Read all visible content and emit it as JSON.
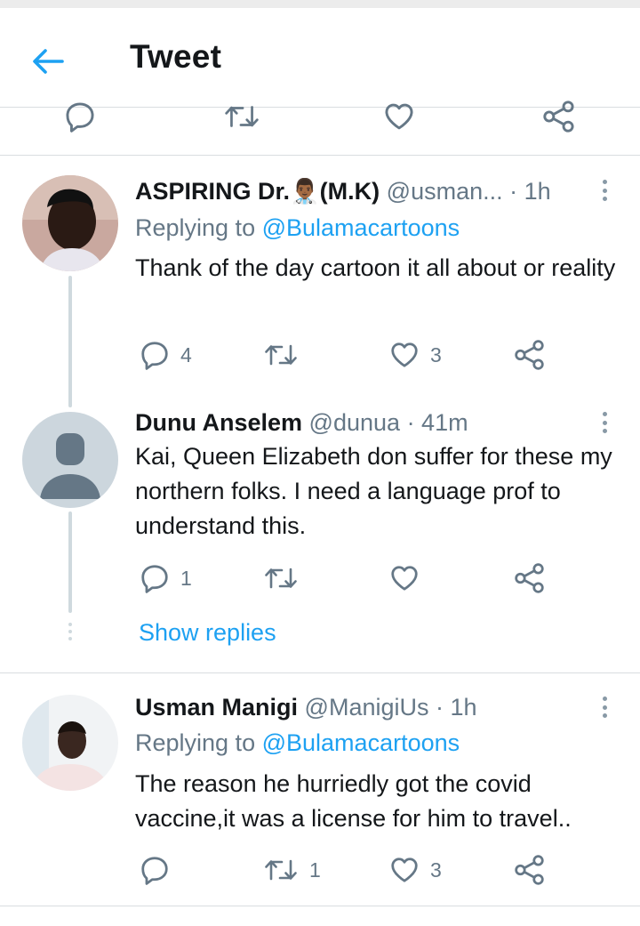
{
  "header": {
    "title": "Tweet",
    "back_icon": "arrow-left-icon",
    "accent_color": "#1da1f2"
  },
  "prev_actions": [
    "reply-icon",
    "retweet-icon",
    "like-icon",
    "share-icon"
  ],
  "tweets": [
    {
      "name": "ASPIRING Dr.👨🏾‍⚕️(M.K)",
      "handle": "@usman...",
      "time": "· 1h",
      "replying_prefix": "Replying to",
      "replying_to": "@Bulamacartoons",
      "text": "Thank of the day cartoon it all about or reality",
      "reply_count": "4",
      "retweet_count": "",
      "like_count": "3"
    },
    {
      "name": "Dunu Anselem",
      "handle": "@dunua",
      "time": "· 41m",
      "text": "Kai, Queen Elizabeth don suffer for these my northern folks. I need a language prof to understand this.",
      "reply_count": "1",
      "retweet_count": "",
      "like_count": "",
      "show_replies": "Show replies"
    },
    {
      "name": "Usman Manigi",
      "handle": "@ManigiUs",
      "time": "· 1h",
      "replying_prefix": "Replying to",
      "replying_to": "@Bulamacartoons",
      "text": "The reason he hurriedly got the covid vaccine,it was a license for him to travel..",
      "reply_count": "",
      "retweet_count": "1",
      "like_count": "3"
    }
  ]
}
